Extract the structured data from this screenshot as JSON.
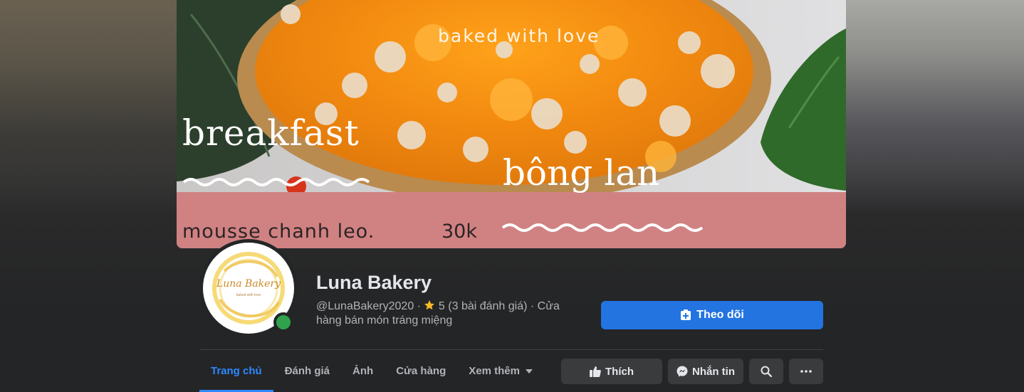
{
  "cover": {
    "tagline": "baked with love",
    "headline_left": "breakfast",
    "headline_right": "bông lan",
    "item_text": "mousse chanh leo.",
    "price_text": "30k"
  },
  "avatar": {
    "brand_text": "Luna Bakery",
    "brand_sub": "baked with love"
  },
  "profile": {
    "name": "Luna Bakery",
    "handle": "@LunaBakery2020",
    "rating_value": "5",
    "rating_count": "(3 bài đánh giá)",
    "category": "Cửa hàng bán món tráng miệng",
    "separator": " · "
  },
  "buttons": {
    "follow": "Theo dõi",
    "like": "Thích",
    "message": "Nhắn tin"
  },
  "tabs": [
    {
      "label": "Trang chủ",
      "active": true
    },
    {
      "label": "Đánh giá",
      "active": false
    },
    {
      "label": "Ảnh",
      "active": false
    },
    {
      "label": "Cửa hàng",
      "active": false
    },
    {
      "label": "Xem thêm",
      "active": false
    }
  ],
  "colors": {
    "accent": "#2374e1",
    "active_tab": "#2d88ff",
    "online": "#31a24c",
    "background": "#242526",
    "button_secondary": "#3a3b3c"
  },
  "icons": {
    "follow": "follow-plus-icon",
    "star": "star-icon",
    "like": "thumbs-up-icon",
    "message": "messenger-icon",
    "search": "search-icon",
    "more": "more-dots-icon",
    "dropdown": "caret-down-icon"
  }
}
